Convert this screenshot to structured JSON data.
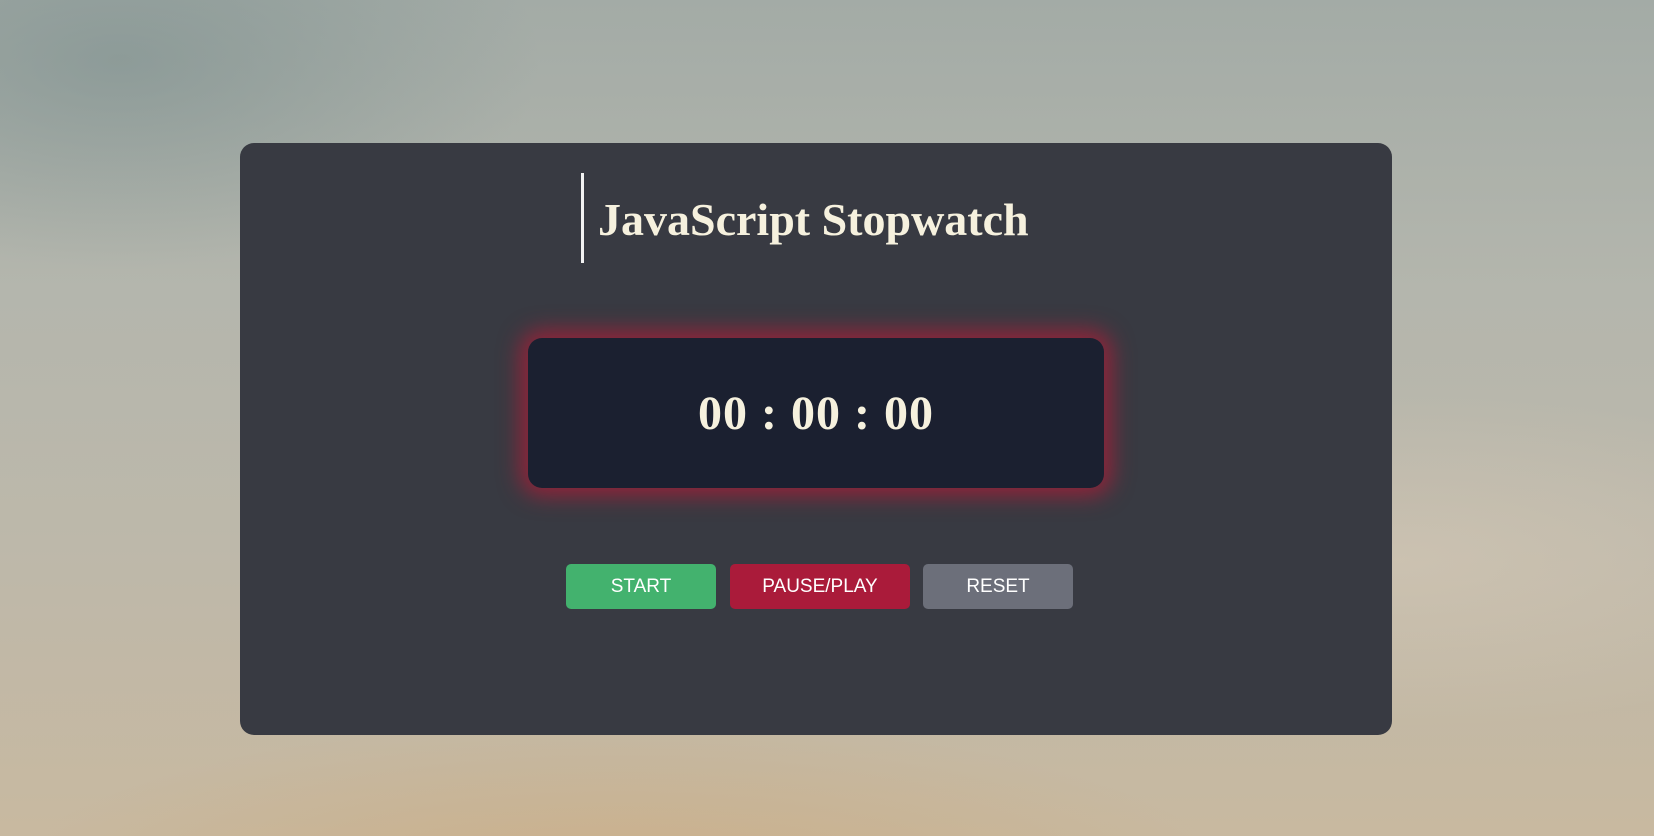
{
  "app": {
    "title": "JavaScript Stopwatch"
  },
  "display": {
    "hours": "00",
    "minutes": "00",
    "seconds": "00",
    "separator": ":"
  },
  "controls": {
    "start_label": "START",
    "pause_label": "PAUSE/PLAY",
    "reset_label": "RESET"
  },
  "colors": {
    "card_background": "#383a42",
    "display_background": "#1b2030",
    "display_glow": "#af1c37",
    "text": "#f6f1de",
    "start_button": "#43b26e",
    "pause_button": "#aa1b3a",
    "reset_button": "#6c6f7a"
  }
}
